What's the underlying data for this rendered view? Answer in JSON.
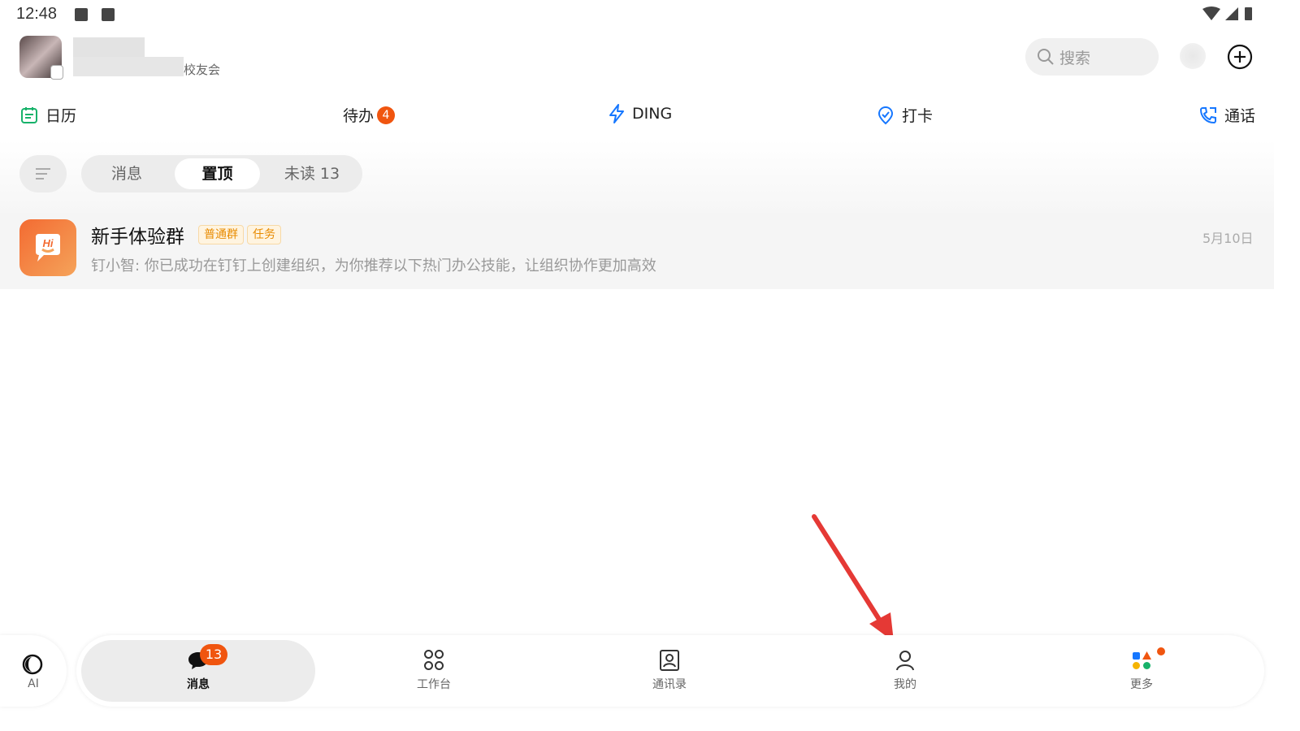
{
  "status_bar": {
    "time": "12:48"
  },
  "header": {
    "org_suffix": "校友会"
  },
  "search": {
    "placeholder": "搜索"
  },
  "quick_bar": {
    "calendar": "日历",
    "todo": "待办",
    "todo_count": "4",
    "ding": "DING",
    "checkin": "打卡",
    "call": "通话"
  },
  "filter": {
    "tabs": [
      {
        "label": "消息"
      },
      {
        "label": "置顶"
      },
      {
        "label": "未读 13"
      }
    ]
  },
  "chat": {
    "title": "新手体验群",
    "tags": [
      "普通群",
      "任务"
    ],
    "preview": "钉小智: 你已成功在钉钉上创建组织，为你推荐以下热门办公技能，让组织协作更加高效",
    "date": "5月10日",
    "avatar_text": "Hi"
  },
  "bottom_nav": {
    "ai": "AI",
    "items": [
      {
        "label": "消息"
      },
      {
        "label": "工作台"
      },
      {
        "label": "通讯录"
      },
      {
        "label": "我的"
      },
      {
        "label": "更多"
      }
    ],
    "message_badge": "13"
  },
  "colors": {
    "accent_orange": "#f0550f",
    "ding_blue": "#1677ff",
    "calendar_green": "#17b26a",
    "arrow_red": "#e53935"
  }
}
